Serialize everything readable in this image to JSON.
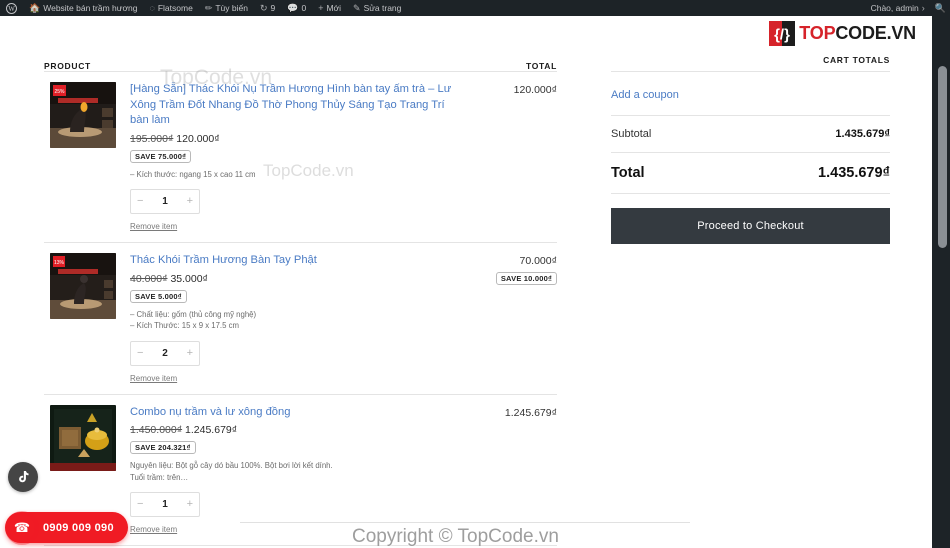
{
  "adminbar": {
    "items": [
      {
        "name": "wp-logo",
        "label": ""
      },
      {
        "name": "site-name",
        "label": "Website bán trầm hương",
        "icon": "house-icon"
      },
      {
        "name": "flatsome",
        "label": "Flatsome",
        "icon": "flatsome-icon"
      },
      {
        "name": "customize",
        "label": "Tùy biến",
        "icon": "brush-icon"
      },
      {
        "name": "updates",
        "label": "9",
        "icon": "refresh-icon"
      },
      {
        "name": "comments",
        "label": "0",
        "icon": "comment-icon"
      },
      {
        "name": "new",
        "label": "Mới",
        "icon": "plus-icon"
      },
      {
        "name": "edit-page",
        "label": "Sửa trang",
        "icon": "pencil-icon"
      }
    ],
    "account_greeting": "Chào, admin",
    "search_icon": "search-icon"
  },
  "brand": {
    "logo_top": "TOP",
    "logo_rest": "CODE.VN",
    "logo_glyph": "{/}",
    "accent_red": "#d6232a",
    "accent_dark": "#1c1c1c"
  },
  "cart": {
    "header_product": "PRODUCT",
    "header_total": "TOTAL",
    "items": [
      {
        "title": "[Hàng Sẵn] Thác Khói Nụ Trầm Hương Hình bàn tay ấm trà – Lư Xông Trầm Đốt Nhang Đồ Thờ Phong Thủy Sáng Tạo Trang Trí bàn làm",
        "price_old": "195.000₫",
        "price_new": "120.000₫",
        "save_badge": "SAVE 75.000₫",
        "desc": "– Kích thước: ngang 15 x cao 11 cm",
        "qty": "1",
        "line_total": "120.000₫",
        "line_save": "",
        "remove_label": "Remove item",
        "minus": "−",
        "plus": "+"
      },
      {
        "title": "Thác Khói Trầm Hương Bàn Tay Phật",
        "price_old": "40.000₫",
        "price_new": "35.000₫",
        "save_badge": "SAVE 5.000₫",
        "desc": "– Chất liệu: gốm (thủ công mỹ nghệ)\n– Kích Thước: 15 x 9 x 17.5 cm",
        "qty": "2",
        "line_total": "70.000₫",
        "line_save": "SAVE 10.000₫",
        "remove_label": "Remove item",
        "minus": "−",
        "plus": "+"
      },
      {
        "title": "Combo nụ trầm và lư xông đồng",
        "price_old": "1.450.000₫",
        "price_new": "1.245.679₫",
        "save_badge": "SAVE 204.321₫",
        "desc": "Nguyên liệu: Bột gỗ cây dó bầu 100%. Bột bơi lời kết dính.\nTuổi trầm: trên…",
        "qty": "1",
        "line_total": "1.245.679₫",
        "line_save": "",
        "remove_label": "Remove item",
        "minus": "−",
        "plus": "+"
      }
    ]
  },
  "totals": {
    "heading": "CART TOTALS",
    "coupon_link": "Add a coupon",
    "subtotal_label": "Subtotal",
    "subtotal_value": "1.435.679₫",
    "total_label": "Total",
    "total_value": "1.435.679₫",
    "checkout_label": "Proceed to Checkout",
    "checkout_bg": "#343a40"
  },
  "floating": {
    "tiktok_icon": "tiktok-icon",
    "phone_icon": "phone-icon",
    "phone_number": "0909 009 090",
    "phone_bg": "#f01b24"
  },
  "watermarks": {
    "top": "TopCode.vn",
    "middle": "TopCode.vn",
    "copyright": "Copyright © TopCode.vn"
  }
}
